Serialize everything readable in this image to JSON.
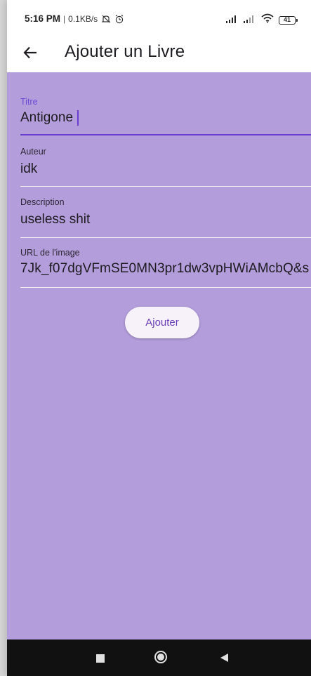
{
  "status_bar": {
    "time": "5:16 PM",
    "separator": "|",
    "speed": "0.1KB/s",
    "battery": "41",
    "icons": [
      "mute-icon",
      "alarm-icon",
      "signal-icon",
      "signal-icon",
      "wifi-icon",
      "battery-icon"
    ]
  },
  "app_bar": {
    "title": "Ajouter un Livre",
    "back_icon": "arrow-back-icon"
  },
  "form": {
    "title": {
      "label": "Titre",
      "value": "Antigone"
    },
    "author": {
      "label": "Auteur",
      "value": "idk"
    },
    "description": {
      "label": "Description",
      "value": "useless shit"
    },
    "image_url": {
      "label": "URL de l'image",
      "value": "7Jk_f07dgVFmSE0MN3pr1dw3vpHWiAMcbQ&s"
    },
    "submit_label": "Ajouter"
  },
  "nav_bar": {
    "icons": [
      "recents-icon",
      "home-icon",
      "back-icon"
    ]
  },
  "colors": {
    "background": "#b39ddb",
    "app_bar": "#ffffff",
    "accent": "#6a3fd0",
    "button_bg": "#f7f2fa",
    "button_text": "#6a3fb5",
    "nav_bar": "#111111"
  }
}
